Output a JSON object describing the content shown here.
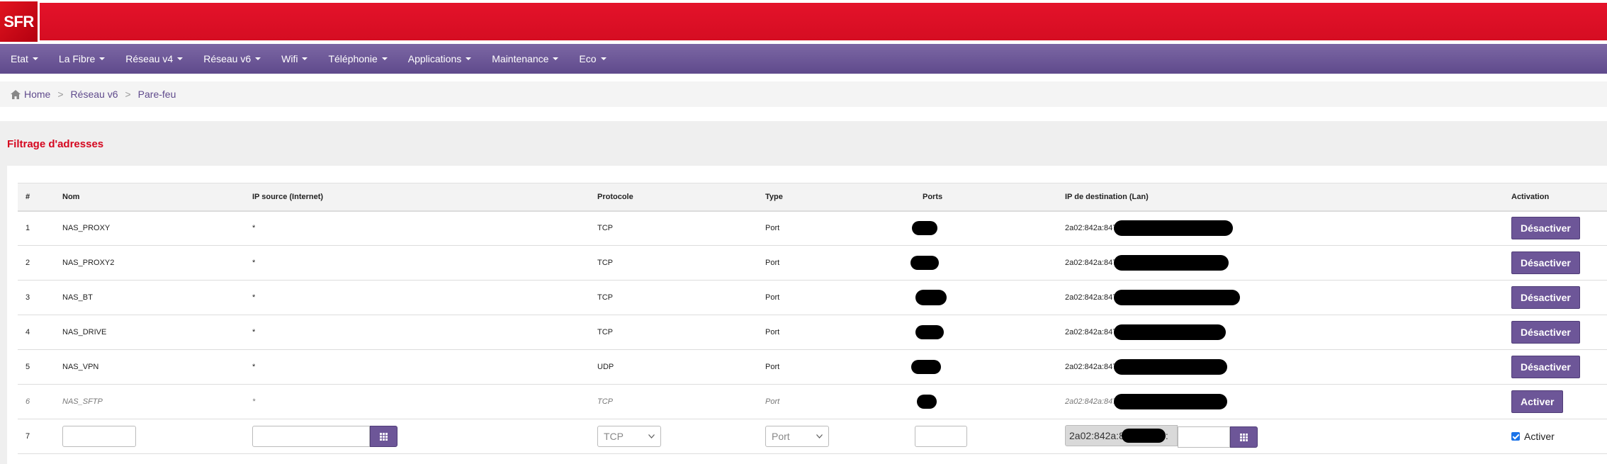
{
  "header": {
    "logo_text": "SFR"
  },
  "nav": {
    "items": [
      {
        "label": "Etat"
      },
      {
        "label": "La Fibre"
      },
      {
        "label": "Réseau v4"
      },
      {
        "label": "Réseau v6"
      },
      {
        "label": "Wifi"
      },
      {
        "label": "Téléphonie"
      },
      {
        "label": "Applications"
      },
      {
        "label": "Maintenance"
      },
      {
        "label": "Eco"
      }
    ]
  },
  "breadcrumb": {
    "home": "Home",
    "level1": "Réseau v6",
    "current": "Pare-feu",
    "separator": ">"
  },
  "section": {
    "title": "Filtrage d'adresses"
  },
  "table": {
    "headers": {
      "num": "#",
      "nom": "Nom",
      "ip_source": "IP source (Internet)",
      "protocole": "Protocole",
      "type": "Type",
      "ports": "Ports",
      "ip_dest": "IP de destination (Lan)",
      "activation": "Activation"
    },
    "rows": [
      {
        "num": "1",
        "nom": "NAS_PROXY",
        "ip_source": "*",
        "protocole": "TCP",
        "type": "Port",
        "ip_dest_prefix": "2a02:842a:847",
        "action": "Désactiver"
      },
      {
        "num": "2",
        "nom": "NAS_PROXY2",
        "ip_source": "*",
        "protocole": "TCP",
        "type": "Port",
        "ip_dest_prefix": "2a02:842a:847",
        "action": "Désactiver"
      },
      {
        "num": "3",
        "nom": "NAS_BT",
        "ip_source": "*",
        "protocole": "TCP",
        "type": "Port",
        "ip_dest_prefix": "2a02:842a:847",
        "action": "Désactiver"
      },
      {
        "num": "4",
        "nom": "NAS_DRIVE",
        "ip_source": "*",
        "protocole": "TCP",
        "type": "Port",
        "ip_dest_prefix": "2a02:842a:847",
        "action": "Désactiver"
      },
      {
        "num": "5",
        "nom": "NAS_VPN",
        "ip_source": "*",
        "protocole": "UDP",
        "type": "Port",
        "ip_dest_prefix": "2a02:842a:847",
        "action": "Désactiver"
      },
      {
        "num": "6",
        "nom": "NAS_SFTP",
        "ip_source": "*",
        "protocole": "TCP",
        "type": "Port",
        "ip_dest_prefix": "2a02:842a:847",
        "action": "Activer"
      }
    ],
    "new_row": {
      "num": "7",
      "protocole_selected": "TCP",
      "type_selected": "Port",
      "ip_dest_prefix": "2a02:842a:8",
      "ip_dest_suffix": ":",
      "activer_label": "Activer"
    }
  },
  "colors": {
    "brand_red": "#e4122a",
    "nav_purple": "#6d5698",
    "title_red": "#d5061f"
  },
  "icons": {
    "home": "home-icon",
    "grid": "grid-icon",
    "caret": "caret-down-icon"
  }
}
